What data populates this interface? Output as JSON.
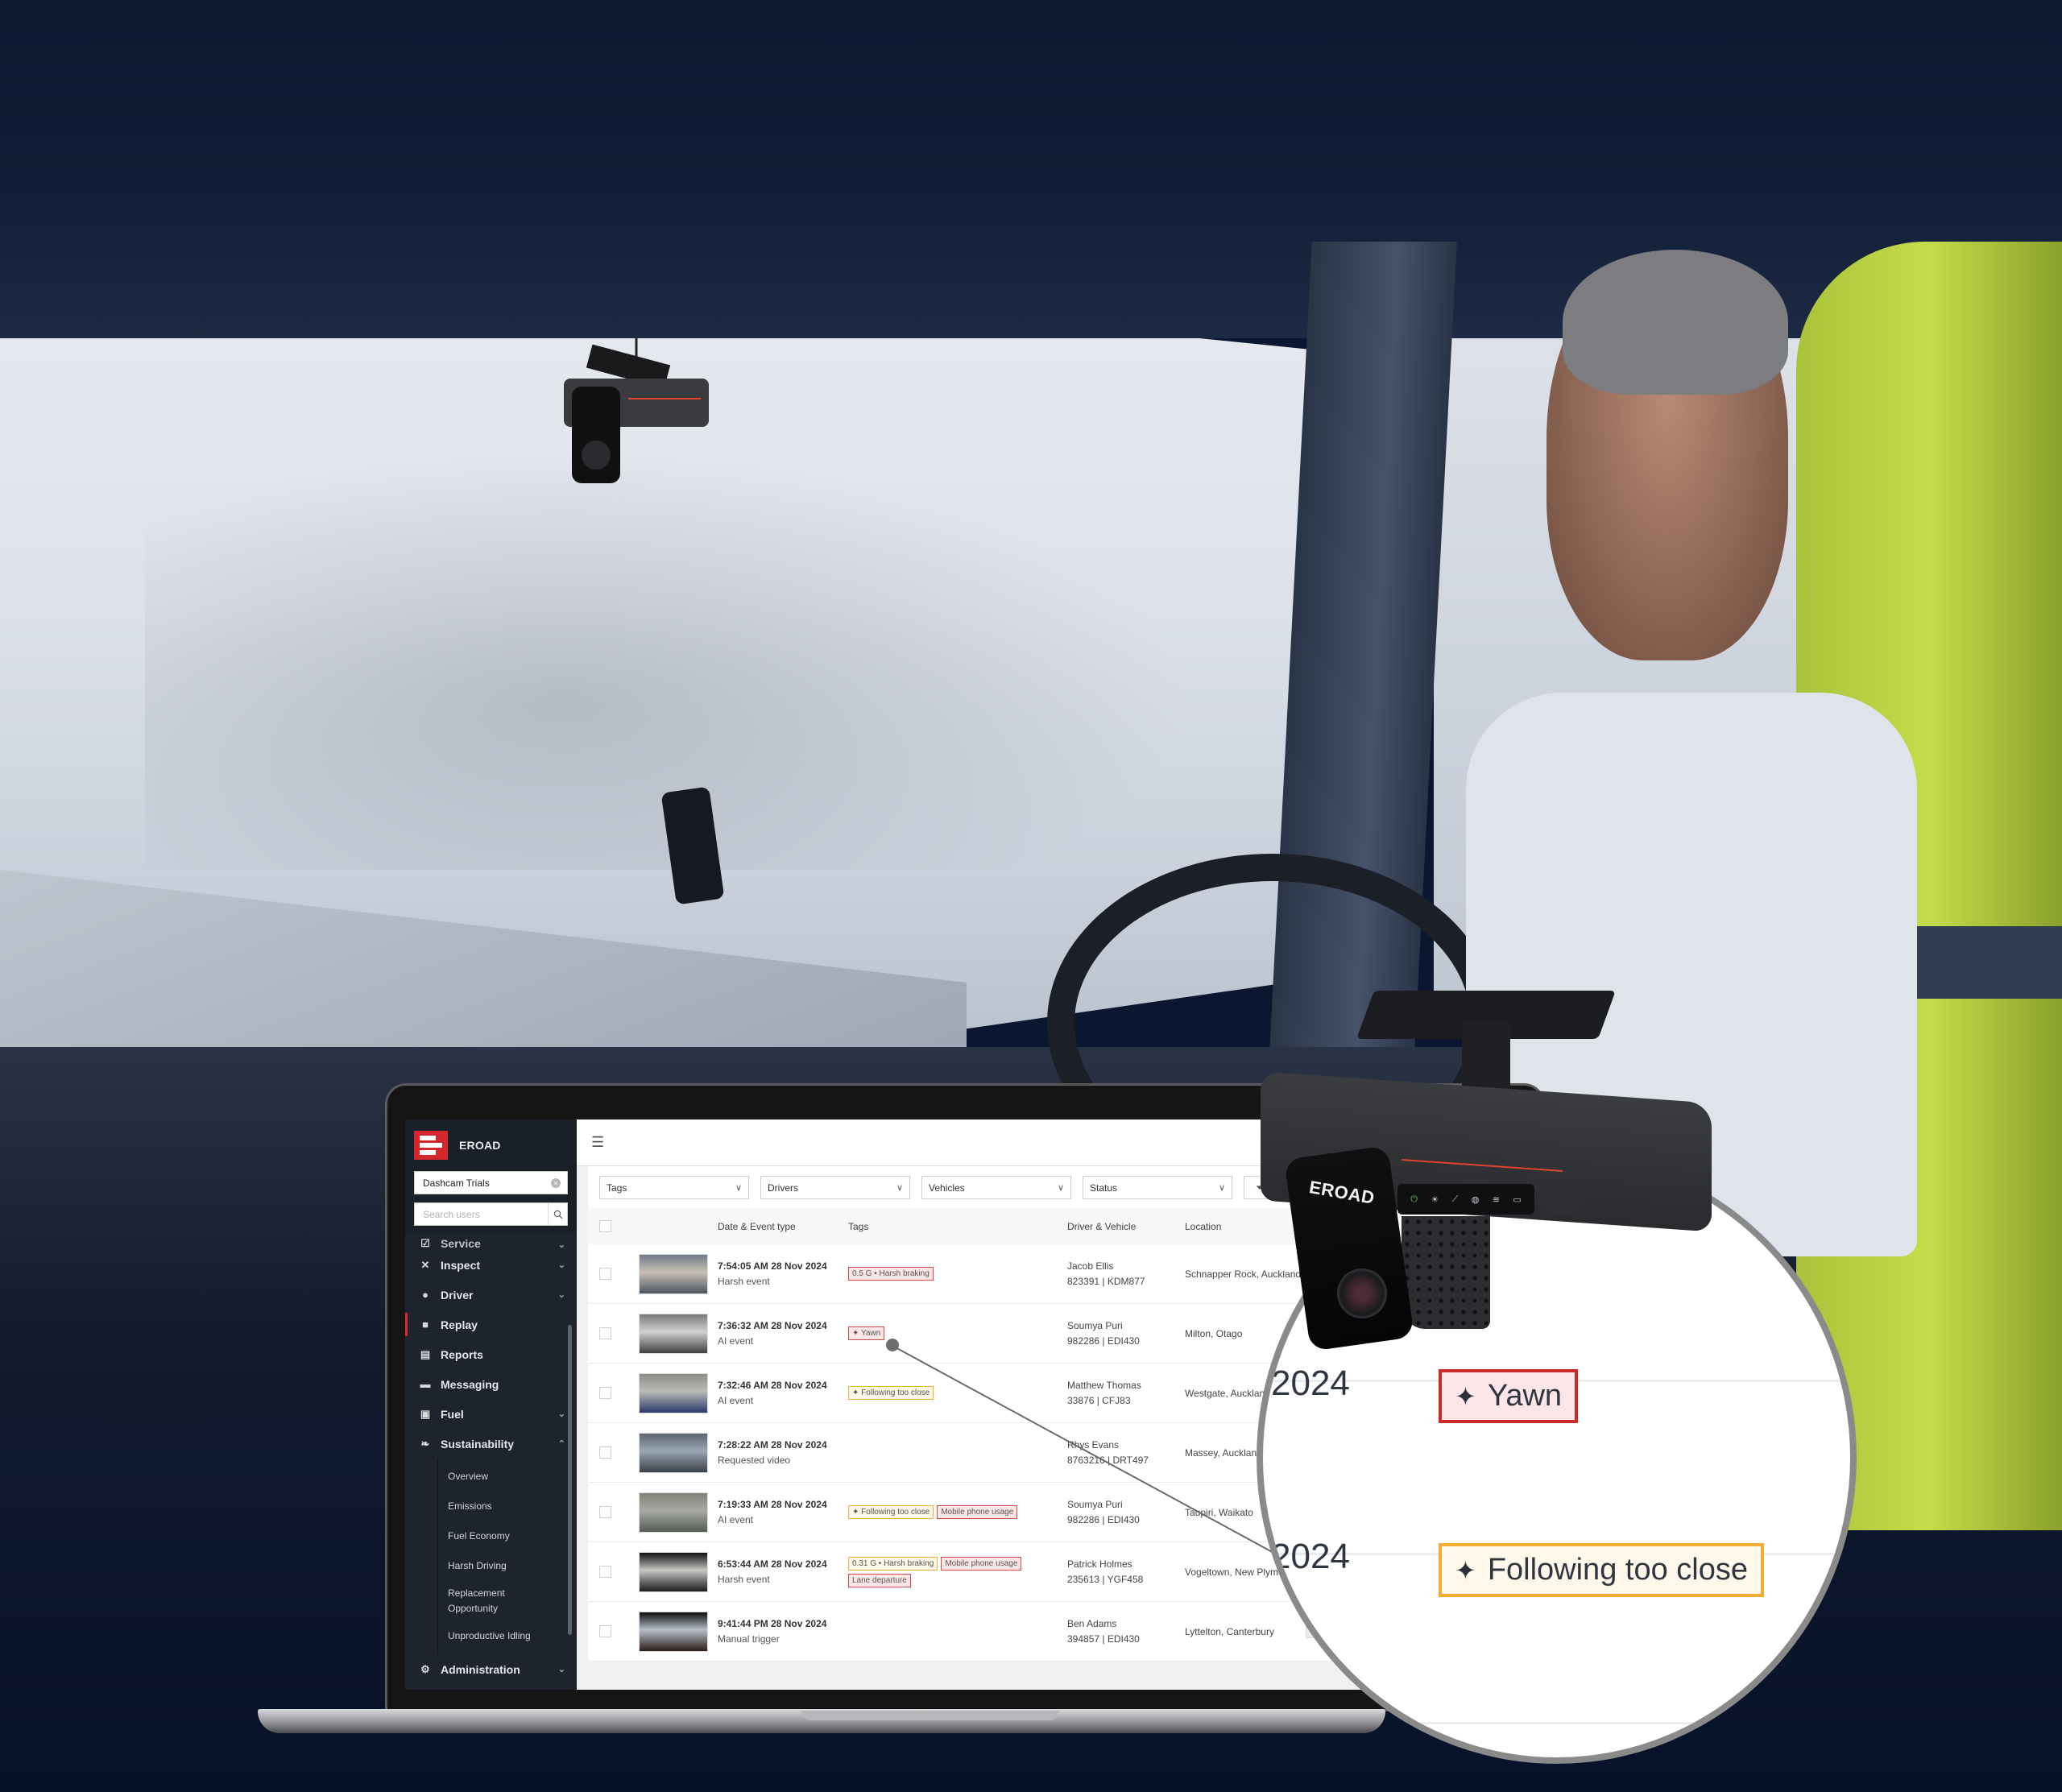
{
  "app": {
    "brand_name": "EROAD",
    "organisation": "Dashcam Trials",
    "user_search_placeholder": "Search users"
  },
  "sidebar": {
    "items": [
      {
        "label": "Service",
        "icon": "checkbox-icon",
        "expandable": true,
        "partial": true
      },
      {
        "label": "Inspect",
        "icon": "tools-icon",
        "expandable": true
      },
      {
        "label": "Driver",
        "icon": "person-icon",
        "expandable": true
      },
      {
        "label": "Replay",
        "icon": "video-camera-icon",
        "expandable": false,
        "active": true
      },
      {
        "label": "Reports",
        "icon": "report-icon",
        "expandable": false
      },
      {
        "label": "Messaging",
        "icon": "chat-bubble-icon",
        "expandable": false
      },
      {
        "label": "Fuel",
        "icon": "fuel-icon",
        "expandable": true
      },
      {
        "label": "Sustainability",
        "icon": "leaf-icon",
        "expandable": true,
        "expanded": true
      },
      {
        "label": "Administration",
        "icon": "admin-user-icon",
        "expandable": true
      }
    ],
    "sustainability_subitems": [
      "Overview",
      "Emissions",
      "Fuel Economy",
      "Harsh Driving",
      "Replacement Opportunity",
      "Unproductive Idling"
    ]
  },
  "toolbar": {
    "filters": [
      "Tags",
      "Drivers",
      "Vehicles",
      "Status"
    ]
  },
  "table": {
    "columns": [
      "Date & Event type",
      "Tags",
      "Driver & Vehicle",
      "Location"
    ],
    "rows": [
      {
        "datetime": "7:54:05 AM 28 Nov 2024",
        "event_type": "Harsh event",
        "tags": [
          {
            "label": "0.5 G • Harsh braking",
            "color": "red",
            "ai": false
          }
        ],
        "driver": "Jacob Ellis",
        "vehicle": "823391 | KDM877",
        "location": "Schnapper Rock, Auckland",
        "thumb_colors": [
          "#6f7a86",
          "#c9c0b6",
          "#4c5660"
        ]
      },
      {
        "datetime": "7:36:32 AM 28 Nov 2024",
        "event_type": "AI event",
        "tags": [
          {
            "label": "Yawn",
            "color": "red",
            "ai": true
          }
        ],
        "driver": "Soumya Puri",
        "vehicle": "982286 | EDI430",
        "location": "Milton, Otago",
        "thumb_colors": [
          "#7a7a7a",
          "#d2d2d2",
          "#3e3e3e"
        ]
      },
      {
        "datetime": "7:32:46 AM 28 Nov 2024",
        "event_type": "AI event",
        "tags": [
          {
            "label": "Following too close",
            "color": "amber",
            "ai": true
          }
        ],
        "driver": "Matthew Thomas",
        "vehicle": "33876 | CFJ83",
        "location": "Westgate, Auckland",
        "thumb_colors": [
          "#8a8e86",
          "#b9bcb4",
          "#2a3a6a"
        ]
      },
      {
        "datetime": "7:28:22 AM 28 Nov 2024",
        "event_type": "Requested video",
        "tags": [],
        "driver": "Rhys Evans",
        "vehicle": "8763216 | DRT497",
        "location": "Massey, Auckland",
        "thumb_colors": [
          "#5d6670",
          "#9aa6b4",
          "#3b4048"
        ]
      },
      {
        "datetime": "7:19:33 AM 28 Nov 2024",
        "event_type": "AI event",
        "tags": [
          {
            "label": "Following too close",
            "color": "amber",
            "ai": true
          },
          {
            "label": "Mobile phone usage",
            "color": "red",
            "ai": false
          }
        ],
        "driver": "Soumya Puri",
        "vehicle": "982286 | EDI430",
        "location": "Taupiri, Waikato",
        "thumb_colors": [
          "#7d8276",
          "#a7aaa4",
          "#555a55"
        ]
      },
      {
        "datetime": "6:53:44 AM 28 Nov 2024",
        "event_type": "Harsh event",
        "tags": [
          {
            "label": "0.31 G • Harsh braking",
            "color": "amber",
            "ai": false
          },
          {
            "label": "Mobile phone usage",
            "color": "red",
            "ai": false
          },
          {
            "label": "Lane departure",
            "color": "red",
            "ai": false
          }
        ],
        "driver": "Patrick Holmes",
        "vehicle": "235613 | YGF458",
        "location": "Vogeltown, New Plymouth",
        "thumb_colors": [
          "#0d0f12",
          "#c4c7c2",
          "#1a1c1f"
        ]
      },
      {
        "datetime": "9:41:44 PM 28 Nov 2024",
        "event_type": "Manual trigger",
        "tags": [],
        "driver": "Ben Adams",
        "vehicle": "394857 | EDI430",
        "location": "Lyttelton, Canterbury",
        "thumb_colors": [
          "#0b0b0c",
          "#b8c0cc",
          "#2a1c16"
        ]
      }
    ]
  },
  "magnifier": {
    "year_label": "2024",
    "tags": [
      {
        "label": "Yawn",
        "color": "red"
      },
      {
        "label": "Following too close",
        "color": "amber"
      }
    ]
  },
  "device": {
    "brand": "EROAD",
    "status_icons": [
      "power-icon",
      "alert-light-icon",
      "gps-off-icon",
      "globe-icon",
      "wifi-icon",
      "camera-icon"
    ]
  },
  "colors": {
    "brand_red": "#d6262d",
    "tag_red_border": "#d34a4a",
    "tag_amber_border": "#f2b03a",
    "sidebar_bg": "#1d242d"
  }
}
